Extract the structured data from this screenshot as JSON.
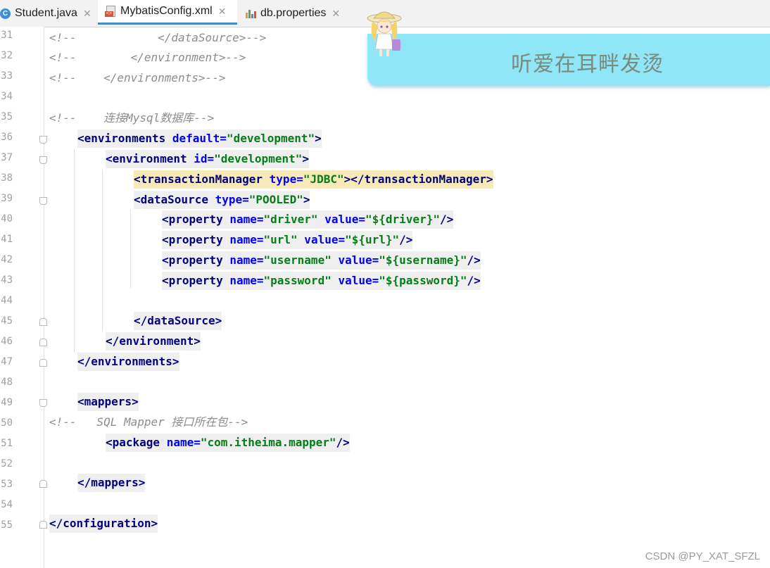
{
  "tabs": [
    {
      "label": "Student.java",
      "icon": "java-class-icon",
      "active": false
    },
    {
      "label": "MybatisConfig.xml",
      "icon": "xml-file-icon",
      "active": true
    },
    {
      "label": "db.properties",
      "icon": "properties-file-icon",
      "active": false
    }
  ],
  "line_numbers": [
    "31",
    "32",
    "33",
    "34",
    "35",
    "36",
    "37",
    "38",
    "39",
    "40",
    "41",
    "42",
    "43",
    "44",
    "45",
    "46",
    "47",
    "48",
    "49",
    "50",
    "51",
    "52",
    "53",
    "54",
    "55"
  ],
  "code": {
    "l31": "<!--            </dataSource>-->",
    "l32": "<!--        </environment>-->",
    "l33": "<!--    </environments>-->",
    "l35": "<!--    连接Mysql数据库-->",
    "l36": {
      "tag": "<environments",
      "attr": " default=",
      "val": "\"development\"",
      "end": ">"
    },
    "l37": {
      "tag": "<environment",
      "attr": " id=",
      "val": "\"development\"",
      "end": ">"
    },
    "l38": {
      "tag": "<transactionManager",
      "attr": " type=",
      "val": "\"JDBC\"",
      "end": "></transactionManager>"
    },
    "l39": {
      "tag": "<dataSource",
      "attr": " type=",
      "val": "\"POOLED\"",
      "end": ">"
    },
    "l40": {
      "tag": "<property",
      "a1": " name=",
      "v1": "\"driver\"",
      "a2": " value=",
      "v2": "\"${driver}\"",
      "end": "/>"
    },
    "l41": {
      "tag": "<property",
      "a1": " name=",
      "v1": "\"url\"",
      "a2": " value=",
      "v2": "\"${url}\"",
      "end": "/>"
    },
    "l42": {
      "tag": "<property",
      "a1": " name=",
      "v1": "\"username\"",
      "a2": " value=",
      "v2": "\"${username}\"",
      "end": "/>"
    },
    "l43": {
      "tag": "<property",
      "a1": " name=",
      "v1": "\"password\"",
      "a2": " value=",
      "v2": "\"${password}\"",
      "end": "/>"
    },
    "l45": "</dataSource>",
    "l46": "</environment>",
    "l47": "</environments>",
    "l49": "<mappers>",
    "l50": "<!--   SQL Mapper 接口所在包-->",
    "l51": {
      "tag": "<package",
      "attr": " name=",
      "val": "\"com.itheima.mapper\"",
      "end": "/>"
    },
    "l53": "</mappers>",
    "l55": "</configuration>"
  },
  "banner": {
    "text": "听爱在耳畔发烫"
  },
  "watermark": "CSDN @PY_XAT_SFZL",
  "colors": {
    "tag": "#000080",
    "attr": "#0000ff",
    "value": "#067d17",
    "comment": "#8c8c8c",
    "banner": "#8fe6f7",
    "highlight": "#f8e9b9"
  }
}
